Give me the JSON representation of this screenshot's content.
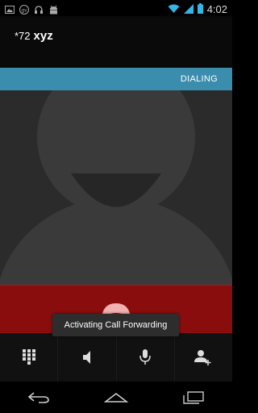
{
  "status_bar": {
    "time": "4:02",
    "left_icons": [
      "image-icon",
      "gv-icon",
      "headset-icon",
      "android-icon"
    ],
    "right_icons": [
      "wifi-icon",
      "signal-icon",
      "battery-icon"
    ]
  },
  "caller": {
    "prefix": "*72",
    "name": "xyz"
  },
  "call_state": {
    "label": "DIALING",
    "accent_color": "#3b8dae"
  },
  "end_call": {
    "color": "#8a0d0d",
    "icon": "end-call-icon"
  },
  "toast": {
    "message": "Activating Call Forwarding"
  },
  "controls": [
    {
      "name": "dialpad",
      "icon": "dialpad-icon"
    },
    {
      "name": "speaker",
      "icon": "speaker-icon"
    },
    {
      "name": "mute",
      "icon": "mute-icon"
    },
    {
      "name": "add-call",
      "icon": "add-call-icon"
    }
  ],
  "nav_bar": [
    {
      "name": "back",
      "icon": "back-icon"
    },
    {
      "name": "home",
      "icon": "home-icon"
    },
    {
      "name": "recents",
      "icon": "recents-icon"
    }
  ]
}
